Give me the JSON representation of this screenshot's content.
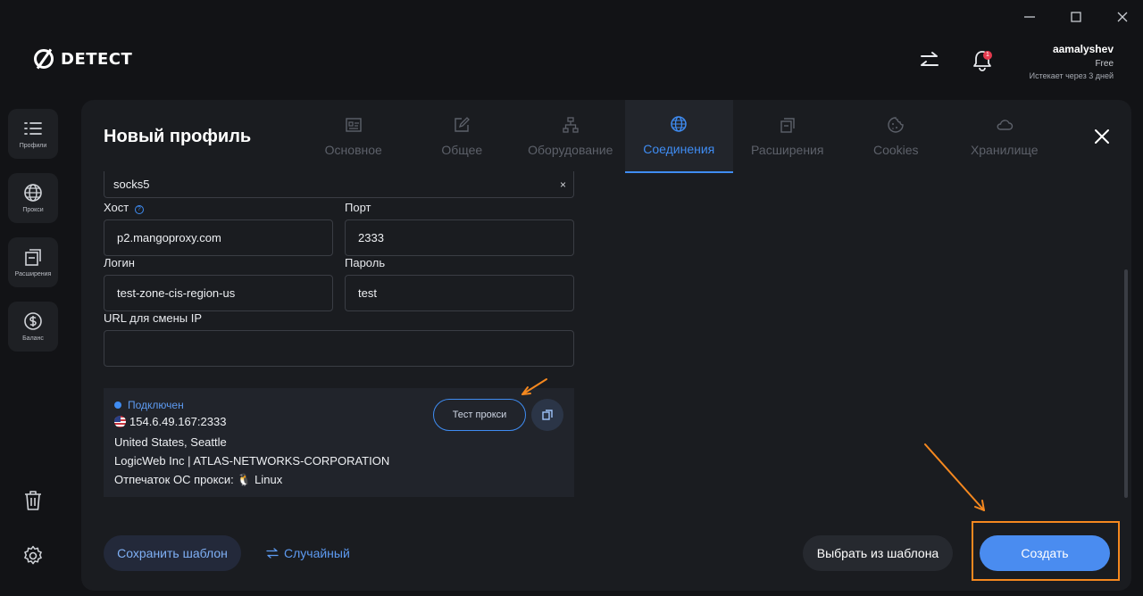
{
  "header": {
    "logo_text": "DETECT",
    "user_name": "aamalyshev",
    "plan": "Free",
    "expires": "Истекает через 3 дней",
    "notification_badge": "1"
  },
  "sidebar": {
    "items": [
      {
        "label": "Профили",
        "icon": "list-icon"
      },
      {
        "label": "Прокси",
        "icon": "globe-icon"
      },
      {
        "label": "Расширения",
        "icon": "extensions-icon"
      },
      {
        "label": "Баланс",
        "icon": "dollar-icon"
      }
    ]
  },
  "panel": {
    "title": "Новый профиль",
    "tabs": [
      {
        "label": "Основное",
        "icon": "id-card-icon",
        "active": false
      },
      {
        "label": "Общее",
        "icon": "edit-icon",
        "active": false
      },
      {
        "label": "Оборудование",
        "icon": "hierarchy-icon",
        "active": false
      },
      {
        "label": "Соединения",
        "icon": "globe-icon",
        "active": true
      },
      {
        "label": "Расширения",
        "icon": "extensions-icon",
        "active": false
      },
      {
        "label": "Cookies",
        "icon": "cookie-icon",
        "active": false
      },
      {
        "label": "Хранилище",
        "icon": "cloud-icon",
        "active": false
      }
    ]
  },
  "form": {
    "proxy_type": "socks5",
    "clear_symbol": "×",
    "help_symbol": "?",
    "host_label": "Хост",
    "host_value": "p2.mangoproxy.com",
    "port_label": "Порт",
    "port_value": "2333",
    "login_label": "Логин",
    "login_value": "test-zone-cis-region-us",
    "password_label": "Пароль",
    "password_value": "test",
    "url_label": "URL для смены IP",
    "url_value": ""
  },
  "proxy_status": {
    "status": "Подключен",
    "ip": "154.6.49.167:2333",
    "location": "United States, Seattle",
    "isp": "LogicWeb Inc | ATLAS-NETWORKS-CORPORATION",
    "os_fingerprint": "Отпечаток ОС прокси: 🐧 Linux",
    "test_button": "Тест прокси"
  },
  "footer": {
    "save_template": "Сохранить шаблон",
    "random": "Случайный",
    "choose_template": "Выбрать из шаблона",
    "create": "Создать"
  },
  "colors": {
    "accent": "#3f8cf2",
    "create_button": "#4a8cf0",
    "highlight": "#f5881f",
    "panel_bg": "#1a1c20",
    "app_bg": "#121316"
  }
}
